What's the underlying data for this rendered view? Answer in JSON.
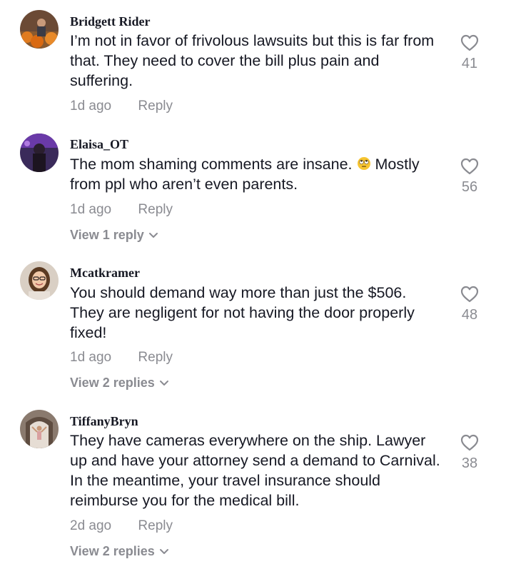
{
  "comments": [
    {
      "username": "Bridgett Rider",
      "text": "I’m not in favor of frivolous lawsuits but this is far from that. They need to cover the bill plus pain and suffering.",
      "time": "1d ago",
      "reply_label": "Reply",
      "likes": "41"
    },
    {
      "username": "Elaisa_OT",
      "text_before_emoji": "The mom shaming comments are insane.",
      "emoji": "face-with-rolling-eyes",
      "text_after_emoji": "Mostly from ppl who aren’t even parents.",
      "time": "1d ago",
      "reply_label": "Reply",
      "view_replies": "View 1 reply",
      "likes": "56"
    },
    {
      "username": "Mcatkramer",
      "text": "You should demand way more than just the $506. They are negligent for not having the door properly fixed!",
      "time": "1d ago",
      "reply_label": "Reply",
      "view_replies": "View 2 replies",
      "likes": "48"
    },
    {
      "username": "TiffanyBryn",
      "text": "They have cameras everywhere on the ship. Lawyer up and have your attorney send a demand to Carnival. In the meantime, your travel insurance should reimburse you for the medical bill.",
      "time": "2d ago",
      "reply_label": "Reply",
      "view_replies": "View 2 replies",
      "likes": "38"
    }
  ],
  "icons": {
    "like": "heart-outline-icon",
    "expand": "chevron-down-icon"
  },
  "colors": {
    "text": "#161823",
    "muted": "#8a8b91",
    "background": "#ffffff"
  }
}
